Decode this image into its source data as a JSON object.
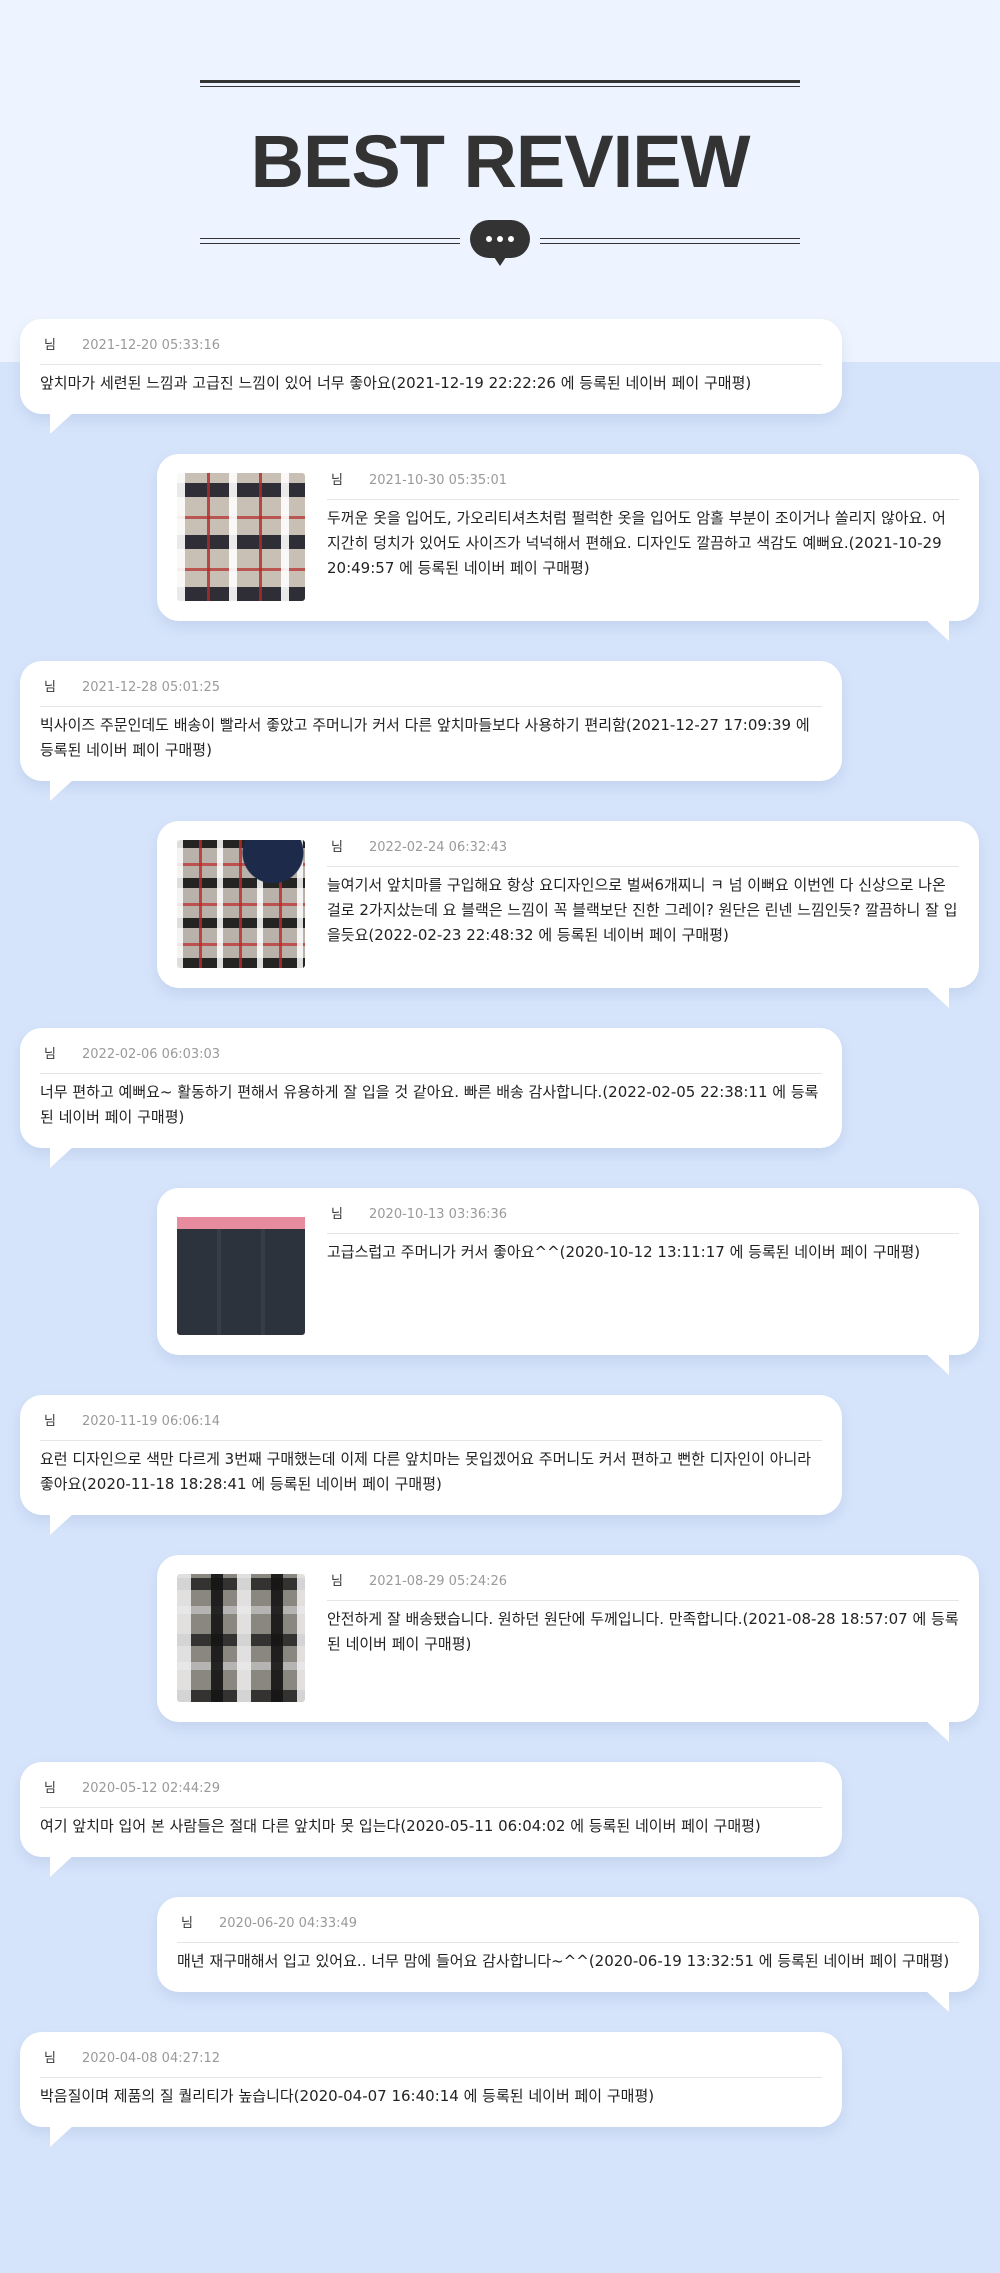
{
  "header": {
    "title": "BEST REVIEW",
    "icon": "chat-bubble-icon"
  },
  "colors": {
    "background": "#d6e4fb",
    "header_background": "#edf4ff",
    "title": "#333333",
    "card": "#ffffff",
    "date": "#9a9a9a"
  },
  "reviews": [
    {
      "author": "님",
      "date": "2021-12-20 05:33:16",
      "text": "앞치마가 세련된 느낌과 고급진 느낌이 있어 너무 좋아요(2021-12-19 22:22:26 에 등록된 네이버 페이 구매평)"
    },
    {
      "author": "님",
      "date": "2021-10-30 05:35:01",
      "text": "두꺼운 옷을 입어도, 가오리티셔츠처럼 펄럭한 옷을 입어도 암홀 부분이 조이거나 쏠리지 않아요. 어지간히 덩치가 있어도 사이즈가 넉넉해서 편해요. 디자인도 깔끔하고 색감도 예뻐요.(2021-10-29 20:49:57 에 등록된 네이버 페이 구매평)",
      "image": "review-photo-plaid-apron"
    },
    {
      "author": "님",
      "date": "2021-12-28 05:01:25",
      "text": "빅사이즈 주문인데도 배송이 빨라서 좋았고 주머니가 커서 다른 앞치마들보다 사용하기 편리함(2021-12-27 17:09:39 에 등록된 네이버 페이 구매평)"
    },
    {
      "author": "님",
      "date": "2022-02-24 06:32:43",
      "text": "늘여기서 앞치마를 구입해요 항상 요디자인으로 벌써6개찌니 ㅋ 넘 이뻐요 이번엔 다 신상으로 나온걸로 2가지샀는데 요 블랙은 느낌이 꼭 블랙보단 진한 그레이? 원단은 린넨 느낌인듯? 깔끔하니 잘 입을듯요(2022-02-23 22:48:32 에 등록된 네이버 페이 구매평)",
      "image": "review-photo-apron-collection"
    },
    {
      "author": "님",
      "date": "2022-02-06 06:03:03",
      "text": "너무 편하고 예뻐요~ 활동하기 편해서 유용하게 잘 입을 것 같아요. 빠른 배송 감사합니다.(2022-02-05 22:38:11 에 등록된 네이버 페이 구매평)"
    },
    {
      "author": "님",
      "date": "2020-10-13 03:36:36",
      "text": "고급스럽고 주머니가 커서 좋아요^^(2020-10-12 13:11:17 에 등록된 네이버 페이 구매평)",
      "image": "review-photo-dark-apron"
    },
    {
      "author": "님",
      "date": "2020-11-19 06:06:14",
      "text": "요런 디자인으로 색만 다르게 3번째 구매했는데 이제 다른 앞치마는 못입겠어요 주머니도 커서 편하고 뻔한 디자인이 아니라 좋아요(2020-11-18 18:28:41 에 등록된 네이버 페이 구매평)"
    },
    {
      "author": "님",
      "date": "2021-08-29 05:24:26",
      "text": "안전하게 잘 배송됐습니다. 원하던 원단에 두께입니다. 만족합니다.(2021-08-28 18:57:07 에 등록된 네이버 페이 구매평)",
      "image": "review-photo-check-apron"
    },
    {
      "author": "님",
      "date": "2020-05-12 02:44:29",
      "text": "여기 앞치마 입어 본 사람들은 절대 다른 앞치마 못 입는다(2020-05-11 06:04:02 에 등록된 네이버 페이 구매평)"
    },
    {
      "author": "님",
      "date": "2020-06-20 04:33:49",
      "text": "매년 재구매해서 입고 있어요.. 너무 맘에 들어요 감사합니다~^^(2020-06-19 13:32:51 에 등록된 네이버 페이 구매평)"
    },
    {
      "author": "님",
      "date": "2020-04-08 04:27:12",
      "text": "박음질이며 제품의 질 퀄리티가 높습니다(2020-04-07 16:40:14 에 등록된 네이버 페이 구매평)"
    }
  ]
}
